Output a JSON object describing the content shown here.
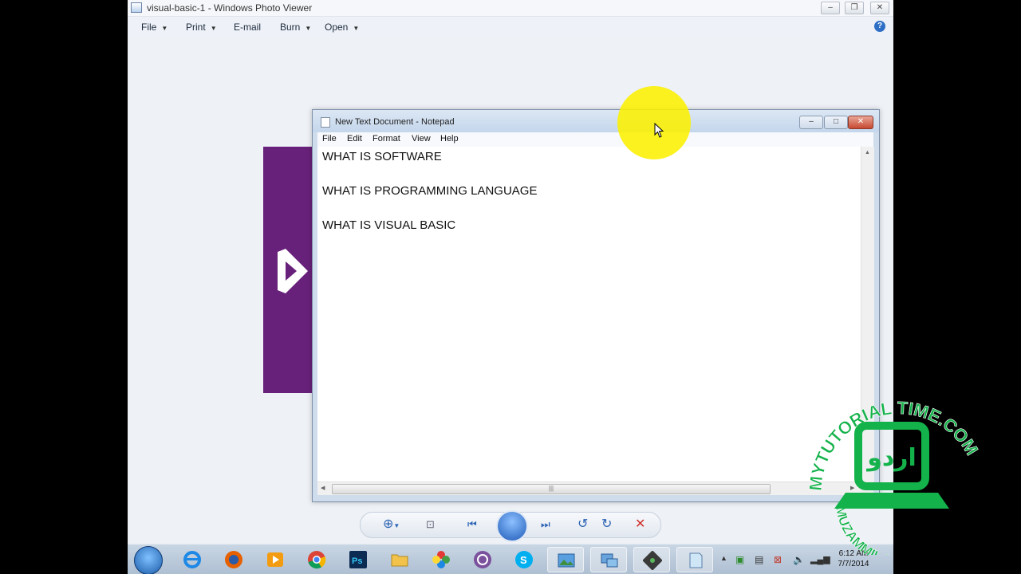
{
  "photo_viewer": {
    "title": "visual-basic-1 - Windows Photo Viewer",
    "menu": [
      "File",
      "Print",
      "E-mail",
      "Burn",
      "Open"
    ]
  },
  "notepad": {
    "title": "New Text Document - Notepad",
    "menu": [
      "File",
      "Edit",
      "Format",
      "View",
      "Help"
    ],
    "lines": [
      "WHAT IS SOFTWARE",
      "WHAT IS PROGRAMMING LANGUAGE",
      "WHAT IS VISUAL BASIC"
    ]
  },
  "image": {
    "background_color": "#68217a"
  },
  "taskbar": {
    "apps": [
      "internet-explorer",
      "firefox",
      "media-player",
      "chrome",
      "photoshop",
      "file-explorer",
      "picasa",
      "viber",
      "skype",
      "photo-viewer",
      "remote-desktop",
      "camtasia",
      "notepad"
    ],
    "clock_time": "6:12 AM",
    "clock_date": "7/7/2014"
  },
  "watermark": {
    "brand": "MYTUTORIAL TIME.COM",
    "author": "MUZAMMIL IJAZ",
    "urdu": "اردو"
  },
  "colors": {
    "watermark_green": "#13b24a",
    "cursor_highlight": "#fcef00",
    "vs_purple": "#68217a"
  }
}
